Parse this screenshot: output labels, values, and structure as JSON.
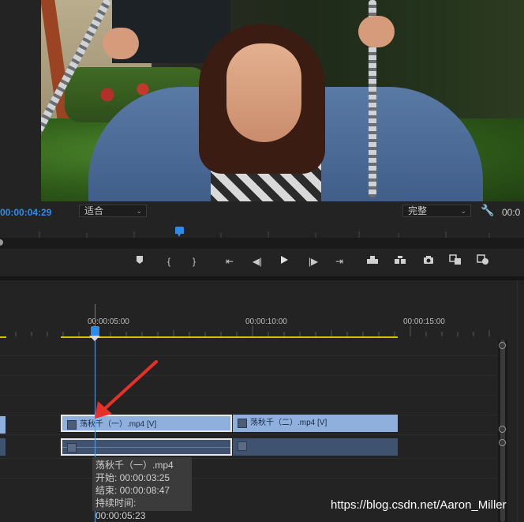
{
  "monitor": {
    "timecode": "00:00:04:29",
    "fit_dropdown": "适合",
    "resolution_dropdown": "完整",
    "timecode_right": "00:0"
  },
  "transport": {
    "buttons": [
      "marker-icon",
      "mark-in-icon",
      "mark-out-icon",
      "go-to-in-icon",
      "step-back-icon",
      "play-icon",
      "step-forward-icon",
      "go-to-out-icon",
      "lift-icon",
      "extract-icon",
      "camera-icon",
      "compare-icon",
      "settings-icon"
    ]
  },
  "timeline": {
    "ruler": [
      "00:00:05:00",
      "00:00:10:00",
      "00:00:15:00"
    ],
    "clips": [
      {
        "label": "荡秋千（一）.mp4 [V]",
        "selected": true
      },
      {
        "label": "荡秋千（二）.mp4 [V]",
        "selected": false
      }
    ],
    "tooltip": {
      "name": "荡秋千（一）.mp4",
      "start": "开始: 00:00:03:25",
      "end": "结束: 00:00:08:47",
      "duration": "持续时间: 00:00:05:23"
    }
  },
  "colors": {
    "accent_blue": "#2d8ceb",
    "clip_video": "#8fb0dd",
    "clip_audio": "#3f5370",
    "work_area": "#d6c200",
    "annotation_arrow": "#e8302a"
  },
  "watermark": "https://blog.csdn.net/Aaron_Miller"
}
